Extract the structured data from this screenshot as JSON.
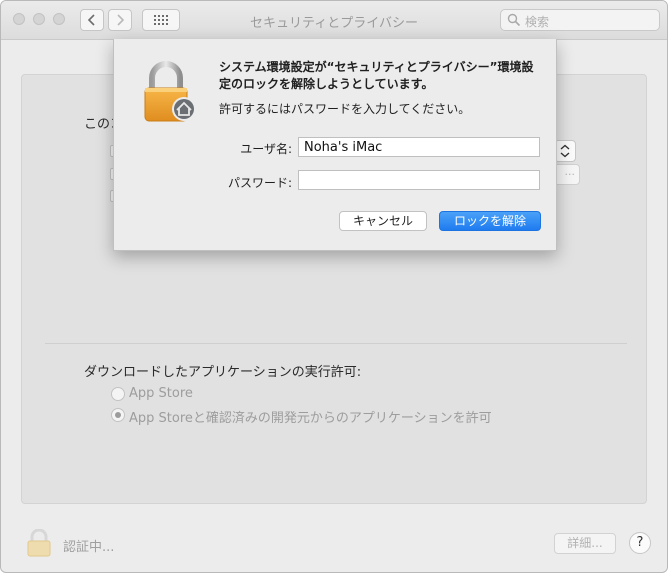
{
  "window": {
    "title": "セキュリティとプライバシー"
  },
  "toolbar": {
    "search_placeholder": "検索"
  },
  "background": {
    "firewall_prefix": "このコ",
    "download_title": "ダウンロードしたアプリケーションの実行許可:",
    "radio_options": [
      {
        "label": "App Store",
        "selected": false
      },
      {
        "label": "App Storeと確認済みの開発元からのアプリケーションを許可",
        "selected": true
      }
    ]
  },
  "bottom": {
    "auth_status": "認証中...",
    "details_label": "詳細...",
    "help_label": "?"
  },
  "dialog": {
    "message": "システム環境設定が“セキュリティとプライバシー”環境設定のロックを解除しようとしています。",
    "info": "許可するにはパスワードを入力してください。",
    "username_label": "ユーザ名:",
    "username_value": "Noha's iMac",
    "password_label": "パスワード:",
    "password_value": "",
    "cancel_label": "キャンセル",
    "unlock_label": "ロックを解除"
  },
  "colors": {
    "accent": "#1f7cf0",
    "lock_gold": "#f0a830"
  }
}
